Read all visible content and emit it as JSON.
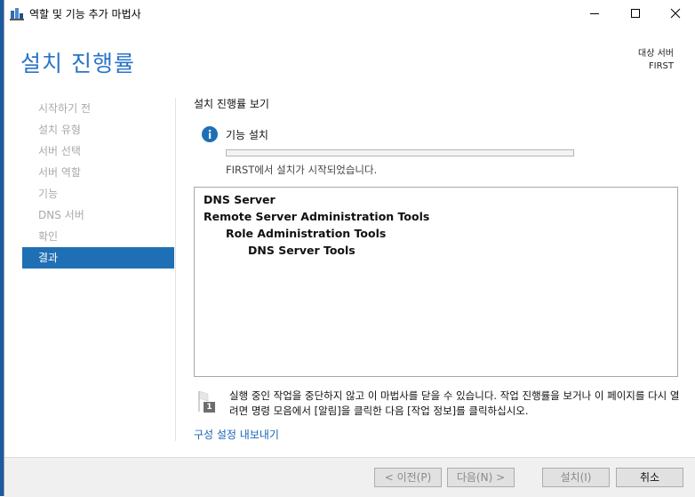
{
  "window": {
    "title": "역할 및 기능 추가 마법사"
  },
  "header": {
    "title": "설치 진행률",
    "target_label": "대상 서버",
    "target_name": "FIRST"
  },
  "nav": {
    "items": [
      {
        "label": "시작하기 전",
        "active": false
      },
      {
        "label": "설치 유형",
        "active": false
      },
      {
        "label": "서버 선택",
        "active": false
      },
      {
        "label": "서버 역할",
        "active": false
      },
      {
        "label": "기능",
        "active": false
      },
      {
        "label": "DNS 서버",
        "active": false
      },
      {
        "label": "확인",
        "active": false
      },
      {
        "label": "결과",
        "active": true
      }
    ]
  },
  "content": {
    "section_title": "설치 진행률 보기",
    "status_title": "기능 설치",
    "progress_fraction": 0.0,
    "status_message": "FIRST에서 설치가 시작되었습니다.",
    "results": [
      {
        "text": "DNS Server",
        "level": 0
      },
      {
        "text": "Remote Server Administration Tools",
        "level": 0
      },
      {
        "text": "Role Administration Tools",
        "level": 1
      },
      {
        "text": "DNS Server Tools",
        "level": 2
      }
    ],
    "note": "실행 중인 작업을 중단하지 않고 이 마법사를 닫을 수 있습니다. 작업 진행률을 보거나 이 페이지를 다시 열려면 명령 모음에서 [알림]을 클릭한 다음 [작업 정보]를 클릭하십시오.",
    "note_badge": "1",
    "export_link": "구성 설정 내보내기"
  },
  "footer": {
    "prev": "< 이전(P)",
    "next": "다음(N) >",
    "install": "설치(I)",
    "cancel": "취소"
  },
  "colors": {
    "accent": "#1f6fb5",
    "header": "#2a74c8",
    "link": "#1a64b8"
  }
}
